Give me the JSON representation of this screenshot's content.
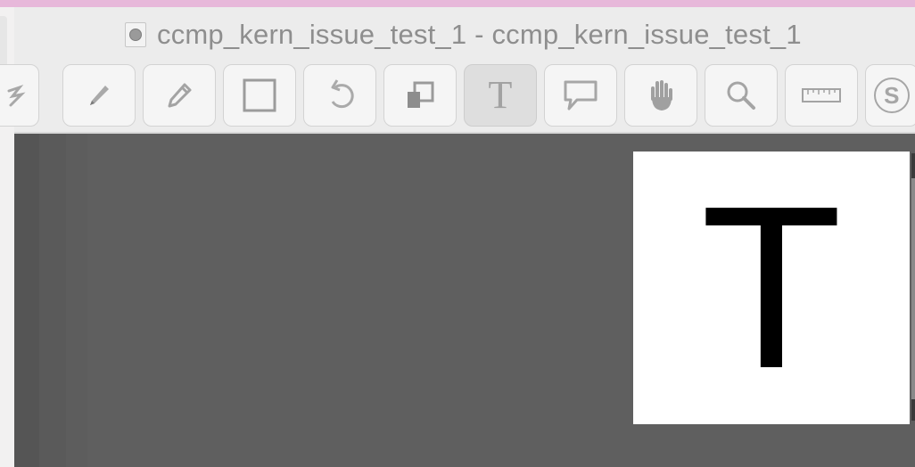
{
  "window": {
    "title": "ccmp_kern_issue_test_1 - ccmp_kern_issue_test_1"
  },
  "toolbar": {
    "tools": [
      {
        "name": "draw-tool",
        "icon": "scribble-icon"
      },
      {
        "name": "pen-tool",
        "icon": "pen-icon"
      },
      {
        "name": "pencil-tool",
        "icon": "pencil-icon"
      },
      {
        "name": "rectangle-tool",
        "icon": "rectangle-icon"
      },
      {
        "name": "rotate-tool",
        "icon": "rotate-icon"
      },
      {
        "name": "arrange-tool",
        "icon": "layers-icon"
      },
      {
        "name": "text-tool",
        "icon": "text-icon",
        "active": true,
        "glyph": "T"
      },
      {
        "name": "speech-bubble-tool",
        "icon": "speech-bubble-icon"
      },
      {
        "name": "hand-tool",
        "icon": "hand-icon"
      },
      {
        "name": "zoom-tool",
        "icon": "magnifier-icon"
      },
      {
        "name": "ruler-tool",
        "icon": "ruler-icon"
      },
      {
        "name": "sign-tool",
        "icon": "signature-icon",
        "glyph": "S"
      }
    ]
  },
  "canvas": {
    "glyph": "T",
    "background": "#5f5f5f",
    "page_color": "#ffffff"
  }
}
